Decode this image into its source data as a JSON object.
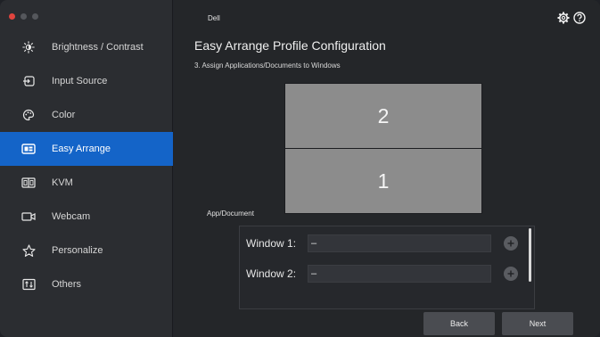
{
  "app": {
    "title": "Dell"
  },
  "sidebar": {
    "items": [
      {
        "label": "Brightness / Contrast",
        "icon": "brightness-icon",
        "active": false
      },
      {
        "label": "Input Source",
        "icon": "input-source-icon",
        "active": false
      },
      {
        "label": "Color",
        "icon": "color-palette-icon",
        "active": false
      },
      {
        "label": "Easy Arrange",
        "icon": "easy-arrange-icon",
        "active": true
      },
      {
        "label": "KVM",
        "icon": "kvm-icon",
        "active": false
      },
      {
        "label": "Webcam",
        "icon": "webcam-icon",
        "active": false
      },
      {
        "label": "Personalize",
        "icon": "star-icon",
        "active": false
      },
      {
        "label": "Others",
        "icon": "others-icon",
        "active": false
      }
    ]
  },
  "main": {
    "page_title": "Easy Arrange Profile Configuration",
    "step_label": "3. Assign Applications/Documents to Windows",
    "layout": {
      "zones": [
        "2",
        "1"
      ]
    },
    "section_label": "App/Document",
    "windows": [
      {
        "label": "Window 1:",
        "value": "–"
      },
      {
        "label": "Window 2:",
        "value": "–"
      }
    ]
  },
  "footer": {
    "back_label": "Back",
    "next_label": "Next"
  },
  "colors": {
    "accent": "#1464c8",
    "zone": "#8c8c8c",
    "background": "#242629",
    "sidebar": "#2b2d31"
  }
}
